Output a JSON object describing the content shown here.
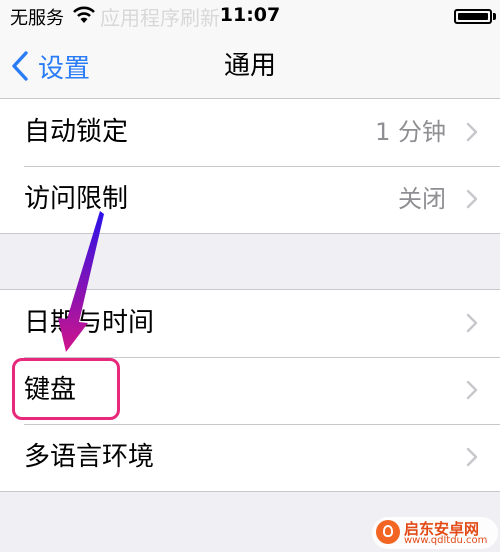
{
  "status_bar": {
    "carrier": "无服务",
    "time": "11:07",
    "faded_text": "应用程序刷新"
  },
  "nav": {
    "back_label": "设置",
    "title": "通用"
  },
  "groups": [
    {
      "rows": [
        {
          "label": "自动锁定",
          "value": "1 分钟"
        },
        {
          "label": "访问限制",
          "value": "关闭"
        }
      ]
    },
    {
      "rows": [
        {
          "label": "日期与时间",
          "value": ""
        },
        {
          "label": "键盘",
          "value": ""
        },
        {
          "label": "多语言环境",
          "value": ""
        }
      ]
    }
  ],
  "colors": {
    "accent": "#2a7cf6",
    "annotation_arrow": "#2a12e8",
    "annotation_highlight": "#e8287b"
  },
  "icons": {
    "wifi": "wifi-icon",
    "battery": "battery-icon",
    "back": "chevron-left-icon",
    "disclosure": "chevron-right-icon"
  },
  "watermark": {
    "name": "启东安卓网",
    "url": "www.qdltdu.com"
  }
}
